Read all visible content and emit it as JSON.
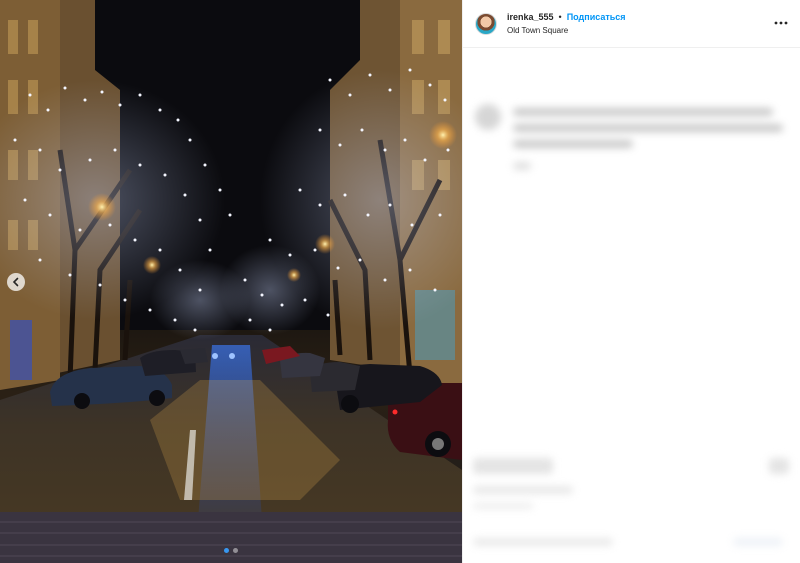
{
  "post": {
    "username": "irenka_555",
    "separator": "•",
    "follow_label": "Подписаться",
    "location": "Old Town Square"
  },
  "icons": {
    "more": "more-horizontal-icon",
    "carousel_prev": "chevron-left-icon",
    "avatar": "avatar"
  },
  "carousel": {
    "slides": 2,
    "active": 1
  },
  "colors": {
    "follow": "#0095f6",
    "accent_dot": "#3897f0"
  }
}
